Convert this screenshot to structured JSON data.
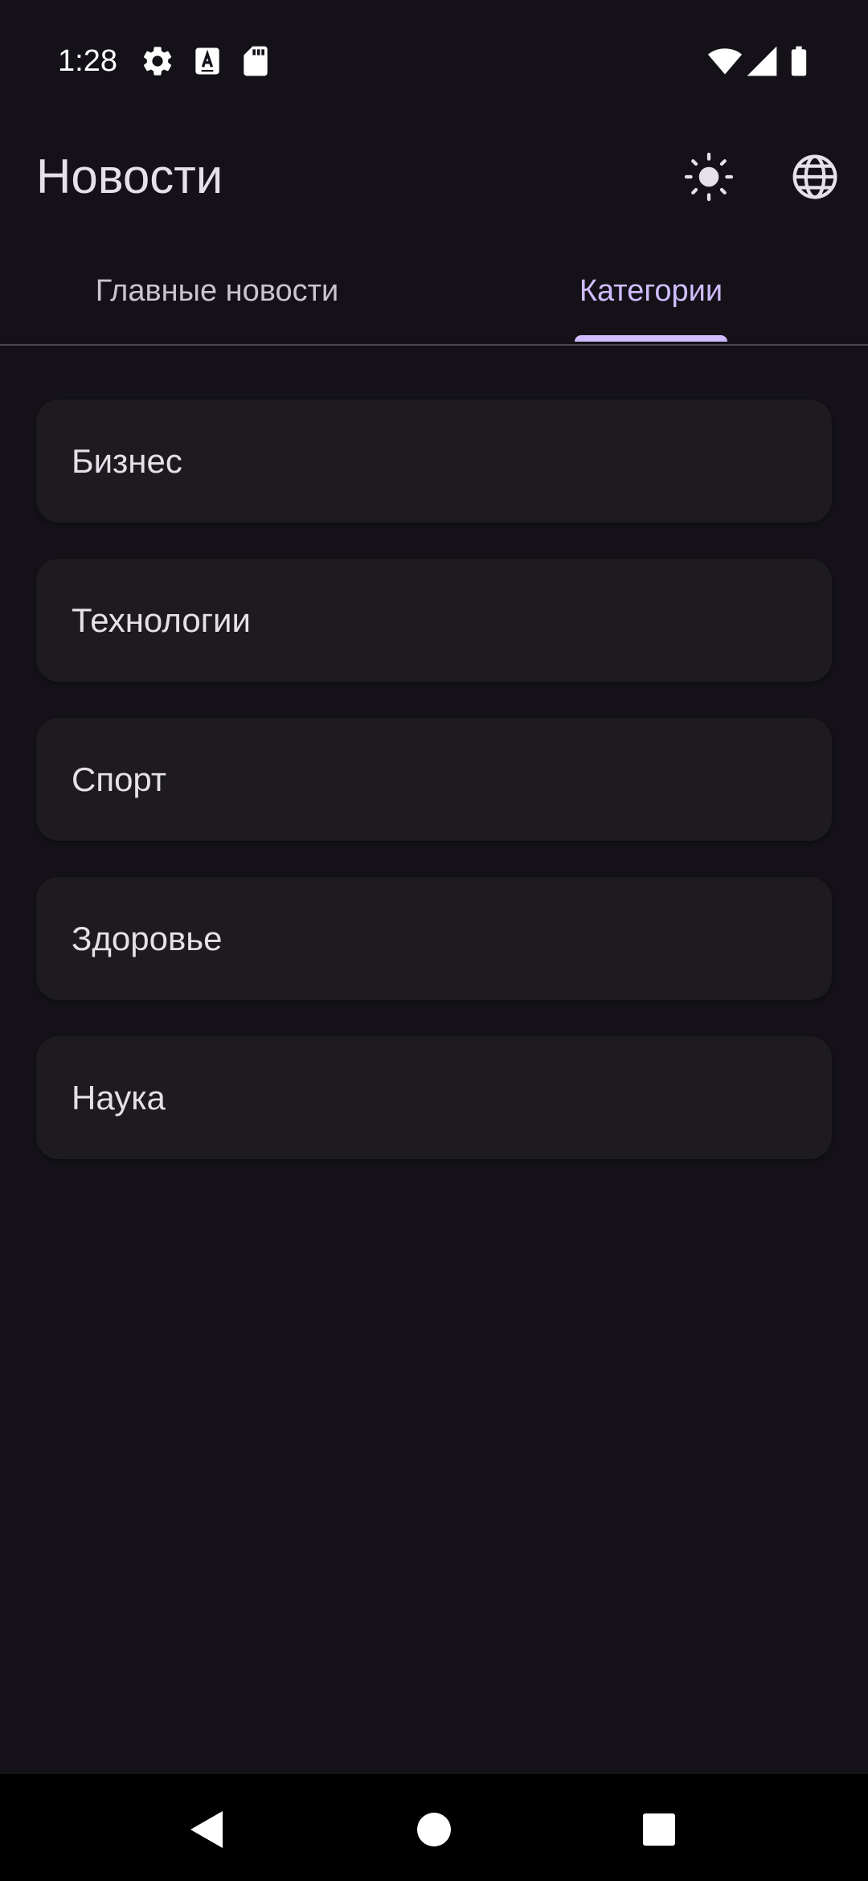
{
  "status_bar": {
    "time": "1:28",
    "left_icons": [
      "settings-icon",
      "font-a-icon",
      "sd-card-icon"
    ],
    "right_icons": [
      "wifi-icon",
      "signal-icon",
      "battery-icon"
    ]
  },
  "app_bar": {
    "title": "Новости",
    "actions": [
      "theme-toggle",
      "language-selector"
    ]
  },
  "tabs": [
    {
      "label": "Главные новости",
      "active": false
    },
    {
      "label": "Категории",
      "active": true
    }
  ],
  "categories": [
    {
      "label": "Бизнес"
    },
    {
      "label": "Технологии"
    },
    {
      "label": "Спорт"
    },
    {
      "label": "Здоровье"
    },
    {
      "label": "Наука"
    }
  ],
  "nav_bar": {
    "buttons": [
      "back",
      "home",
      "recents"
    ]
  },
  "colors": {
    "background": "#141218",
    "surface": "#1d1b20",
    "accent": "#d0bcff",
    "text_primary": "#e6e0e9",
    "text_secondary": "#cac4d0"
  }
}
